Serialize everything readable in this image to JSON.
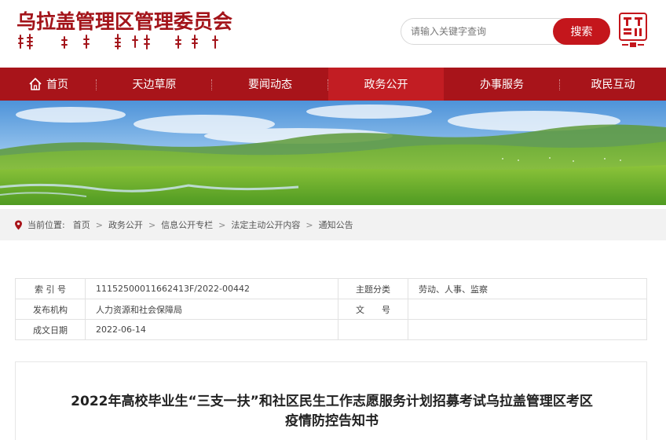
{
  "site": {
    "title": "乌拉盖管理区管理委员会",
    "mongolian_logo_text": "ᠤᠯᠠᠭᠠᠢ ᠶᠢᠨ ᠵᠠᠰᠠᠭ ᠤᠨ ᠲᠣᠭᠣᠷᠢᠭ"
  },
  "search": {
    "placeholder": "请输入关键字查询",
    "button_label": "搜索"
  },
  "nav": {
    "items": [
      {
        "label": "首页"
      },
      {
        "label": "天边草原"
      },
      {
        "label": "要闻动态"
      },
      {
        "label": "政务公开"
      },
      {
        "label": "办事服务"
      },
      {
        "label": "政民互动"
      }
    ],
    "active_index": 3
  },
  "breadcrumb": {
    "prefix": "当前位置:",
    "items": [
      "首页",
      "政务公开",
      "信息公开专栏",
      "法定主动公开内容",
      "通知公告"
    ],
    "separator": ">"
  },
  "info_table": {
    "index_label": "索 引 号",
    "index_value": "11152500011662413F/2022-00442",
    "category_label": "主题分类",
    "category_value": "劳动、人事、监察",
    "publisher_label": "发布机构",
    "publisher_value": "人力资源和社会保障局",
    "doc_no_label": "文　　号",
    "doc_no_value": "",
    "date_label": "成文日期",
    "date_value": "2022-06-14"
  },
  "article": {
    "title_line1": "2022年高校毕业生“三支一扶”和社区民生工作志愿服务计划招募考试乌拉盖管理区考区",
    "title_line2": "疫情防控告知书"
  },
  "colors": {
    "brand_red": "#a8141a",
    "active_red": "#c21d23",
    "search_button": "#c4161c"
  }
}
